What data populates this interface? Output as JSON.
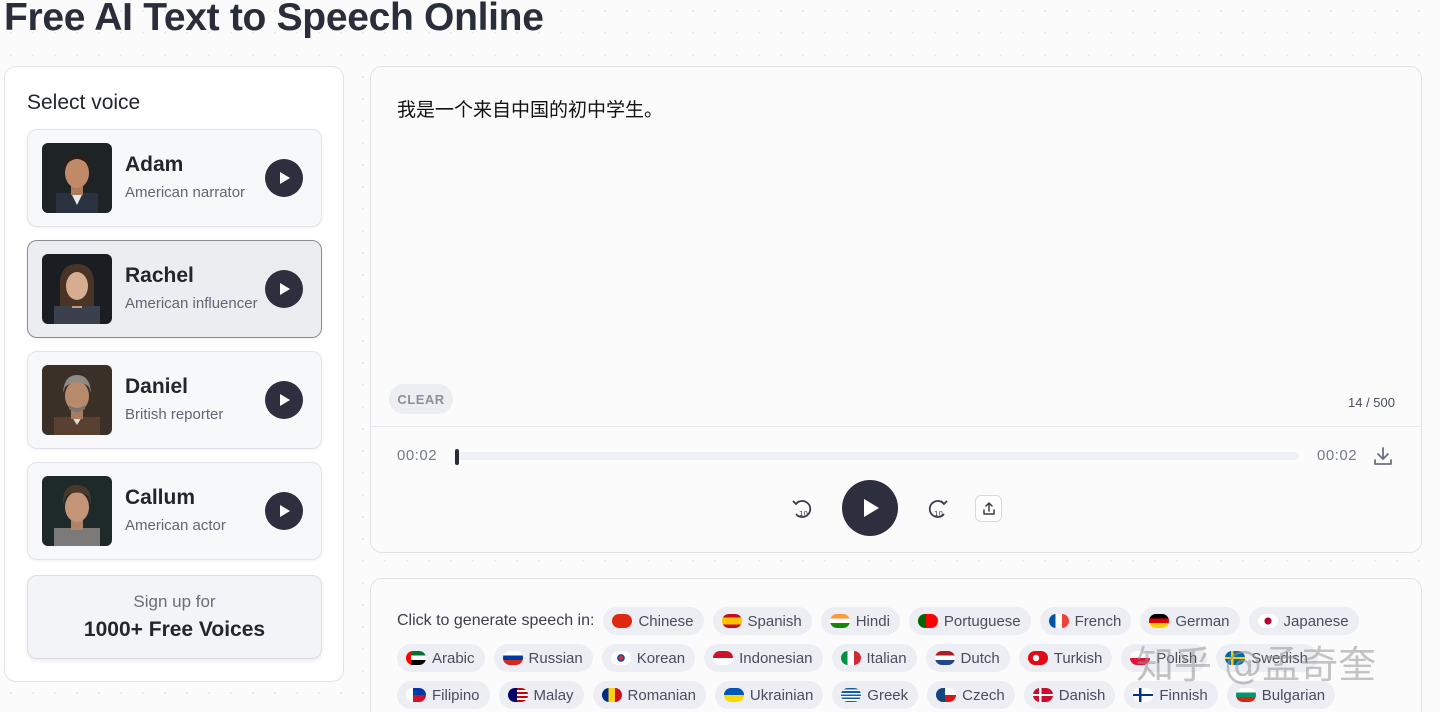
{
  "page": {
    "title": "Free AI Text to Speech Online"
  },
  "voice_panel": {
    "title": "Select voice",
    "voices": [
      {
        "name": "Adam",
        "description": "American narrator",
        "selected": false
      },
      {
        "name": "Rachel",
        "description": "American influencer",
        "selected": true
      },
      {
        "name": "Daniel",
        "description": "British reporter",
        "selected": false
      },
      {
        "name": "Callum",
        "description": "American actor",
        "selected": false
      }
    ],
    "signup": {
      "line1": "Sign up for",
      "line2": "1000+ Free Voices"
    }
  },
  "editor": {
    "text": "我是一个来自中国的初中学生。",
    "clear_label": "CLEAR",
    "char_count": "14 / 500"
  },
  "player": {
    "current_time": "00:02",
    "duration": "00:02",
    "progress": 0,
    "icons": {
      "rewind": "rewind-10-icon",
      "play": "play-icon",
      "forward": "forward-10-icon",
      "share": "share-icon",
      "download": "download-icon"
    }
  },
  "languages": {
    "label": "Click to generate speech in:",
    "rows": [
      [
        "Chinese",
        "Spanish",
        "Hindi",
        "Portuguese",
        "French",
        "German",
        "Japanese"
      ],
      [
        "Arabic",
        "Russian",
        "Korean",
        "Indonesian",
        "Italian",
        "Dutch",
        "Turkish",
        "Polish",
        "Swedish"
      ],
      [
        "Filipino",
        "Malay",
        "Romanian",
        "Ukrainian",
        "Greek",
        "Czech",
        "Danish",
        "Finnish",
        "Bulgarian"
      ]
    ]
  },
  "watermark": "知乎 @孟奇奎",
  "colors": {
    "accent": "#2d2e3e",
    "panel_border": "#e1e3e8",
    "chip_bg": "#eceef3"
  }
}
